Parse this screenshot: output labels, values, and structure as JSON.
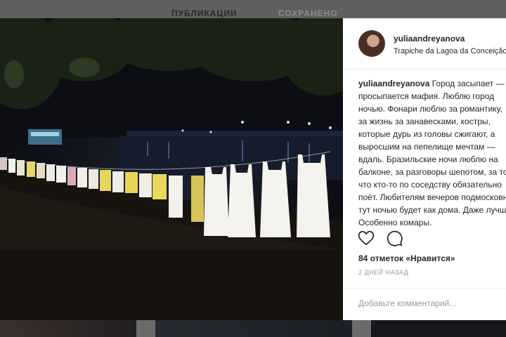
{
  "tabs": {
    "posts": "ПУБЛИКАЦИИ",
    "saved": "СОХРАНЕНО"
  },
  "post": {
    "username": "yuliaandreyanova",
    "location": "Trapiche da Lagoa da Conceição",
    "caption_user": "yuliaandreyanova",
    "caption_lines": [
      " Город засыпает —",
      "просыпается мафия. Люблю город",
      "ночью. Фонари люблю за романтику,",
      "за жизнь за занавесками, костры,",
      "которые дурь из головы сжигают, а",
      "выросшим на пепелище мечтам —",
      "вдаль. Бразильские ночи люблю на",
      "балконе, за разговоры шепотом, за то,",
      "что кто-то по соседству обязательно",
      "поёт. Любителям вечеров подмосковных",
      "тут ночью будет как дома. Даже лучше.",
      "Особенно комары."
    ],
    "likes": "84 отметок «Нравится»",
    "timestamp": "2 ДНЕЙ НАЗАД",
    "comment_placeholder": "Добавьте комментарий..."
  },
  "icons": {
    "like": "heart-icon",
    "comment": "comment-icon"
  }
}
